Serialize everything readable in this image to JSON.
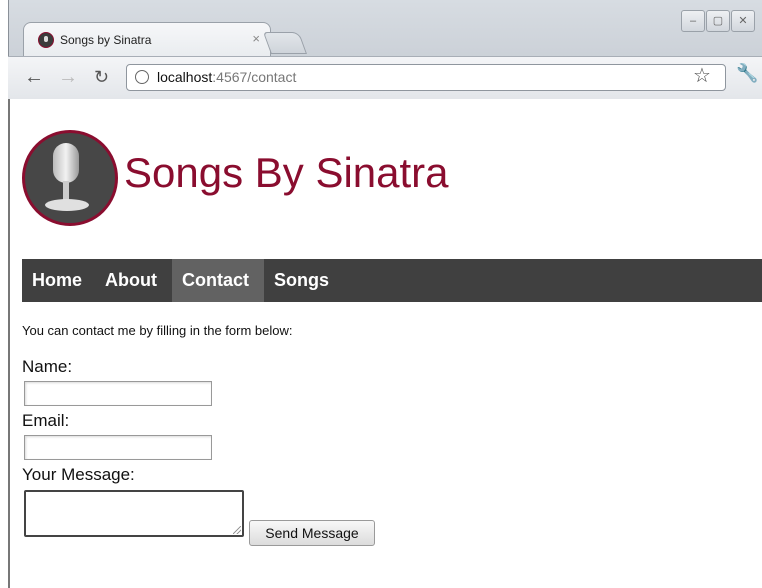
{
  "browser": {
    "tab_title": "Songs by Sinatra",
    "tab_close": "×",
    "url_host": "localhost",
    "url_rest": ":4567/contact",
    "back_icon": "arrow-left",
    "forward_icon": "arrow-right",
    "reload_icon": "reload",
    "bookmark_icon": "star",
    "settings_icon": "wrench"
  },
  "site": {
    "title": "Songs By Sinatra",
    "logo_icon": "microphone",
    "brand_color": "#8a0d2f"
  },
  "nav": {
    "items": [
      {
        "label": "Home",
        "active": false
      },
      {
        "label": "About",
        "active": false
      },
      {
        "label": "Contact",
        "active": true
      },
      {
        "label": "Songs",
        "active": false
      }
    ]
  },
  "contact": {
    "intro": "You can contact me by filling in the form below:",
    "name_label": "Name:",
    "name_value": "",
    "email_label": "Email:",
    "email_value": "",
    "message_label": "Your Message:",
    "message_value": "",
    "send_label": "Send Message"
  }
}
